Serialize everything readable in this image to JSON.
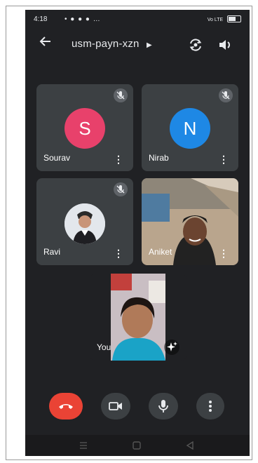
{
  "status_bar": {
    "time": "4:18",
    "icons_left": "• ● ● ● …",
    "icons_right": "Vo LTE"
  },
  "header": {
    "meeting_code": "usm-payn-xzn",
    "back_icon": "arrow-left-icon",
    "flip_camera_icon": "flip-camera-icon",
    "speaker_icon": "speaker-icon"
  },
  "participants": [
    {
      "name": "Sourav",
      "initial": "S",
      "muted": true,
      "avatar_color": "#e8416b"
    },
    {
      "name": "Nirab",
      "initial": "N",
      "muted": true,
      "avatar_color": "#1e88e5"
    },
    {
      "name": "Ravi",
      "initial": "",
      "muted": true,
      "avatar_color": ""
    },
    {
      "name": "Aniket",
      "initial": "",
      "muted": false,
      "avatar_color": ""
    }
  ],
  "self_view": {
    "name": "You"
  },
  "controls": {
    "end_call_color": "#ea4335",
    "icons": [
      "end-call-icon",
      "camera-icon",
      "microphone-icon",
      "more-options-icon"
    ]
  },
  "nav": {
    "icons": [
      "menu-nav-icon",
      "home-nav-icon",
      "back-nav-icon"
    ]
  }
}
